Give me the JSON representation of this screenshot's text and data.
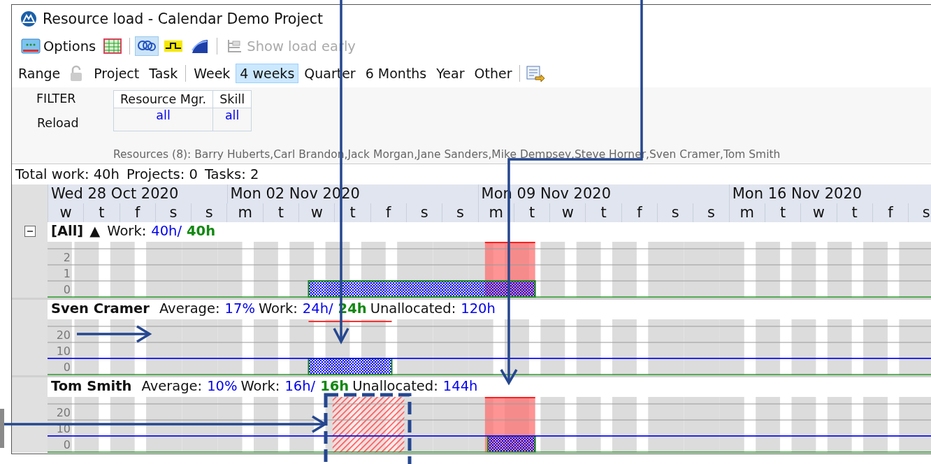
{
  "window": {
    "title": "Resource load - Calendar Demo Project"
  },
  "toolbar": [
    {
      "label": "Options",
      "selected": false
    },
    {
      "selected": false
    },
    {
      "selected": true
    },
    {
      "selected": false
    },
    {
      "selected": false
    },
    {
      "label": "Show load early",
      "selected": false,
      "disabled": true
    }
  ],
  "range": {
    "label": "Range",
    "scopes": [
      "Project",
      "Task"
    ],
    "periods": [
      {
        "label": "Week",
        "selected": false
      },
      {
        "label": "4 weeks",
        "selected": true
      },
      {
        "label": "Quarter",
        "selected": false
      },
      {
        "label": "6 Months",
        "selected": false
      },
      {
        "label": "Year",
        "selected": false
      },
      {
        "label": "Other",
        "selected": false
      }
    ]
  },
  "filter": {
    "title": "FILTER",
    "reload": "Reload",
    "columns": [
      {
        "header": "Resource Mgr.",
        "value": "all"
      },
      {
        "header": "Skill",
        "value": "all"
      }
    ],
    "resources": "Resources (8): Barry Huberts,Carl Brandon,Jack Morgan,Jane Sanders,Mike Dempsey,Steve Horner,Sven Cramer,Tom Smith"
  },
  "summary": [
    "Total work: 40h",
    "Projects: 0",
    "Tasks: 2"
  ],
  "timeline": {
    "weeks": [
      {
        "label": "Wed 28 Oct 2020",
        "days": [
          {
            "label": "w",
            "weekend": false
          },
          {
            "label": "t",
            "weekend": false
          },
          {
            "label": "f",
            "weekend": false
          },
          {
            "label": "s",
            "weekend": true
          },
          {
            "label": "s",
            "weekend": true
          }
        ]
      },
      {
        "label": "Mon 02 Nov 2020",
        "days": [
          {
            "label": "m",
            "weekend": false
          },
          {
            "label": "t",
            "weekend": false
          },
          {
            "label": "w",
            "weekend": false
          },
          {
            "label": "t",
            "weekend": false
          },
          {
            "label": "f",
            "weekend": false
          },
          {
            "label": "s",
            "weekend": true
          },
          {
            "label": "s",
            "weekend": true
          }
        ]
      },
      {
        "label": "Mon 09 Nov 2020",
        "days": [
          {
            "label": "m",
            "weekend": false
          },
          {
            "label": "t",
            "weekend": false
          },
          {
            "label": "w",
            "weekend": false
          },
          {
            "label": "t",
            "weekend": false
          },
          {
            "label": "f",
            "weekend": false
          },
          {
            "label": "s",
            "weekend": true
          },
          {
            "label": "s",
            "weekend": true
          }
        ]
      },
      {
        "label": "Mon 16 Nov 2020",
        "days": [
          {
            "label": "m",
            "weekend": false
          },
          {
            "label": "t",
            "weekend": false
          },
          {
            "label": "w",
            "weekend": false
          },
          {
            "label": "t",
            "weekend": false
          },
          {
            "label": "f",
            "weekend": false
          },
          {
            "label": "s",
            "weekend": true
          }
        ]
      }
    ]
  },
  "sections": [
    {
      "name": "[All]",
      "expanded": true,
      "sort_mark": "▲",
      "stats": [
        {
          "label": "Work:",
          "value": "40h/",
          "planned": "40h"
        }
      ],
      "axis_labels": [
        "2",
        "1",
        "0"
      ]
    },
    {
      "name": "Sven Cramer",
      "stats": [
        {
          "label": "Average:",
          "value": "17%"
        },
        {
          "label": "Work:",
          "value": "24h/",
          "planned": "24h"
        },
        {
          "label": "Unallocated:",
          "value": "120h"
        }
      ],
      "axis_labels": [
        "20",
        "10",
        "0"
      ]
    },
    {
      "name": "Tom Smith",
      "stats": [
        {
          "label": "Average:",
          "value": "10%"
        },
        {
          "label": "Work:",
          "value": "16h/",
          "planned": "16h"
        },
        {
          "label": "Unallocated:",
          "value": "144h"
        }
      ],
      "axis_labels": [
        "20",
        "10",
        "0"
      ]
    }
  ]
}
